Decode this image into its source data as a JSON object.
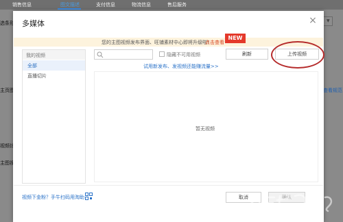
{
  "background": {
    "tabs": [
      "销售信息",
      "图文描述",
      "支付信息",
      "物流信息",
      "售后服务"
    ],
    "active_tab": 1,
    "left_labels": [
      "选条形",
      "主页图",
      "视频比",
      "主图视"
    ],
    "right_link": "查看规范"
  },
  "modal": {
    "title": "多媒体",
    "close_icon": "close-icon",
    "notice": {
      "text": "您的主图视频发布界面、旺铺素材中心即将升级啦！",
      "link": "点击查看",
      "badge": "NEW"
    },
    "sidebar": {
      "header": "我的视频",
      "items": [
        {
          "label": "全部",
          "active": true
        },
        {
          "label": "直播切片",
          "active": false
        }
      ]
    },
    "toolbar": {
      "search_placeholder": "",
      "hide_unavailable_label": "隐藏不可用视频",
      "refresh_label": "刷新",
      "upload_label": "上传视频"
    },
    "trial_link": "试用新发布、发视频还能赚流量>>",
    "empty_text": "暂无视频",
    "footer": {
      "help_link": "视频下金粉？手牛扫码用淘助",
      "cancel_label": "取消",
      "confirm_label": "确认"
    }
  },
  "colors": {
    "accent": "#2a72c8",
    "notice_bg": "#fdf3dd",
    "badge": "#e4392b",
    "annotation_circle": "#b52b2b"
  }
}
